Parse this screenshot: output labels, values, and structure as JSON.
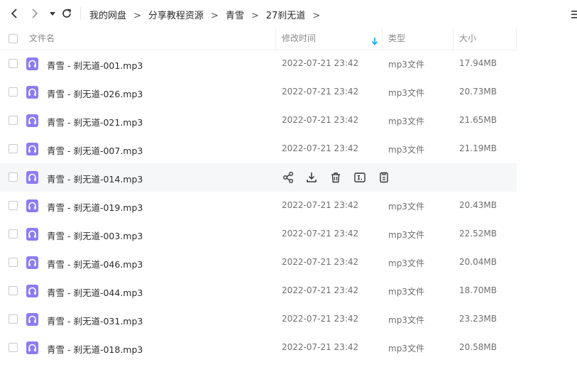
{
  "breadcrumb": [
    "我的网盘",
    "分享教程资源",
    "青雪",
    "27刹无道"
  ],
  "breadcrumb_separator": ">",
  "columns": {
    "name": "文件名",
    "modified": "修改时间",
    "type": "类型",
    "size": "大小"
  },
  "sort": {
    "column": "modified",
    "direction": "descending",
    "icon": "sort-down-arrow-icon"
  },
  "files": [
    {
      "name": "青雪 - 刹无道-001.mp3",
      "modified": "2022-07-21 23:42",
      "type": "mp3文件",
      "size": "17.94MB"
    },
    {
      "name": "青雪 - 刹无道-026.mp3",
      "modified": "2022-07-21 23:42",
      "type": "mp3文件",
      "size": "20.73MB"
    },
    {
      "name": "青雪 - 刹无道-021.mp3",
      "modified": "2022-07-21 23:42",
      "type": "mp3文件",
      "size": "21.65MB"
    },
    {
      "name": "青雪 - 刹无道-007.mp3",
      "modified": "2022-07-21 23:42",
      "type": "mp3文件",
      "size": "21.19MB"
    },
    {
      "name": "青雪 - 刹无道-014.mp3",
      "hovered": true
    },
    {
      "name": "青雪 - 刹无道-019.mp3",
      "modified": "2022-07-21 23:42",
      "type": "mp3文件",
      "size": "20.43MB"
    },
    {
      "name": "青雪 - 刹无道-003.mp3",
      "modified": "2022-07-21 23:42",
      "type": "mp3文件",
      "size": "22.52MB"
    },
    {
      "name": "青雪 - 刹无道-046.mp3",
      "modified": "2022-07-21 23:42",
      "type": "mp3文件",
      "size": "20.04MB"
    },
    {
      "name": "青雪 - 刹无道-044.mp3",
      "modified": "2022-07-21 23:42",
      "type": "mp3文件",
      "size": "18.70MB"
    },
    {
      "name": "青雪 - 刹无道-031.mp3",
      "modified": "2022-07-21 23:42",
      "type": "mp3文件",
      "size": "23.23MB"
    },
    {
      "name": "青雪 - 刹无道-018.mp3",
      "modified": "2022-07-21 23:42",
      "type": "mp3文件",
      "size": "20.58MB"
    }
  ],
  "hover_actions": [
    "share-icon",
    "download-icon",
    "delete-icon",
    "rename-icon",
    "copy-icon"
  ],
  "colors": {
    "file_icon": "#8b7cf6",
    "accent": "#06a7ff",
    "hover_row": "#f6f7f9"
  }
}
